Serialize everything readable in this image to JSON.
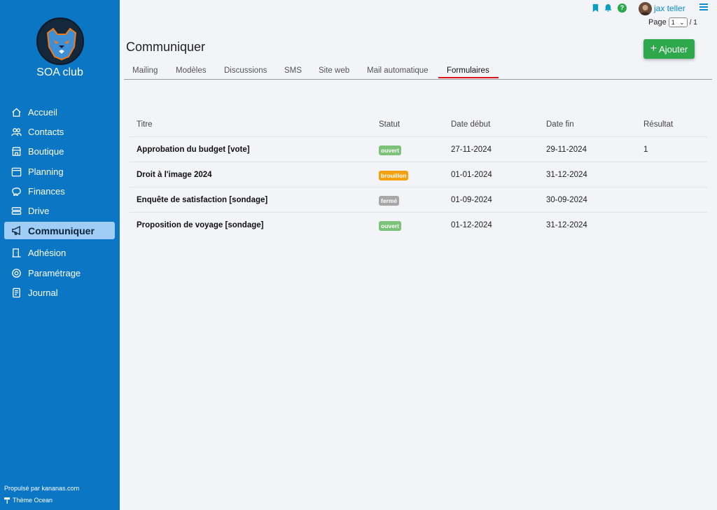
{
  "sidebar": {
    "club_name": "SOA club",
    "items": [
      {
        "label": "Accueil",
        "icon": "home-icon"
      },
      {
        "label": "Contacts",
        "icon": "users-icon"
      },
      {
        "label": "Boutique",
        "icon": "shop-icon"
      },
      {
        "label": "Planning",
        "icon": "calendar-icon"
      },
      {
        "label": "Finances",
        "icon": "piggy-bank-icon"
      },
      {
        "label": "Drive",
        "icon": "drive-icon"
      },
      {
        "label": "Communiquer",
        "icon": "megaphone-icon",
        "active": true
      },
      {
        "label": "Adhésion",
        "icon": "door-icon"
      },
      {
        "label": "Paramétrage",
        "icon": "gear-icon"
      },
      {
        "label": "Journal",
        "icon": "journal-icon"
      }
    ],
    "powered_by": "Propulsé par kananas.com",
    "theme": "Thème Ocean"
  },
  "topbar": {
    "username": "jax teller",
    "page_label": "Page",
    "page_value": "1",
    "page_total": "/ 1",
    "help": "?"
  },
  "main": {
    "title": "Communiquer",
    "add_label": "Ajouter",
    "tabs": [
      "Mailing",
      "Modèles",
      "Discussions",
      "SMS",
      "Site web",
      "Mail automatique",
      "Formulaires"
    ],
    "active_tab": "Formulaires"
  },
  "table": {
    "headers": [
      "Titre",
      "Statut",
      "Date début",
      "Date fin",
      "Résultat"
    ],
    "rows": [
      {
        "title": "Approbation du budget [vote]",
        "status": "ouvert",
        "start": "27-11-2024",
        "end": "29-11-2024",
        "result": "1"
      },
      {
        "title": "Droit à l'image 2024",
        "status": "brouillon",
        "start": "01-01-2024",
        "end": "31-12-2024",
        "result": ""
      },
      {
        "title": "Enquête de satisfaction [sondage]",
        "status": "fermé",
        "start": "01-09-2024",
        "end": "30-09-2024",
        "result": ""
      },
      {
        "title": "Proposition de voyage [sondage]",
        "status": "ouvert",
        "start": "01-12-2024",
        "end": "31-12-2024",
        "result": ""
      }
    ]
  },
  "colors": {
    "sidebar_bg": "#0a76c4",
    "active_item_bg": "#9fcdf5",
    "add_button": "#2ea84a",
    "tab_underline": "#e0141c",
    "status_ouvert": "#7cc27a",
    "status_brouillon": "#f5a00f",
    "status_ferme": "#a7a7a7"
  }
}
